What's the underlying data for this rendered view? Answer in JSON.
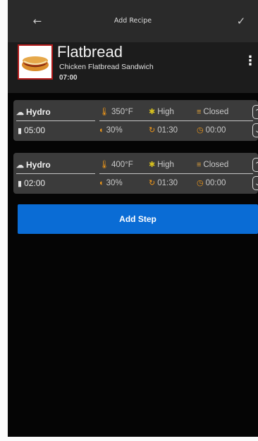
{
  "topbar": {
    "title": "Add Recipe",
    "back_icon": "back-arrow-icon",
    "confirm_icon": "checkmark-icon"
  },
  "recipe": {
    "name": "Flatbread",
    "subtitle": "Chicken Flatbread Sandwich",
    "total_time": "07:00",
    "more_icon": "more-vertical-icon"
  },
  "steps": [
    {
      "mode": "Hydro",
      "temperature": "350°F",
      "fan": "High",
      "vent": "Closed",
      "duration": "05:00",
      "humidity": "30%",
      "interval": "01:30",
      "delay": "00:00"
    },
    {
      "mode": "Hydro",
      "temperature": "400°F",
      "fan": "High",
      "vent": "Closed",
      "duration": "02:00",
      "humidity": "30%",
      "interval": "01:30",
      "delay": "00:00"
    }
  ],
  "add_step_label": "Add Step",
  "colors": {
    "accent": "#0a6cd5",
    "card": "#3b3b3b",
    "topbar": "#2a2a2a",
    "thumb_border": "#b31b1b",
    "temp_icon": "#f39a1a",
    "fan_icon": "#d9c21f"
  }
}
